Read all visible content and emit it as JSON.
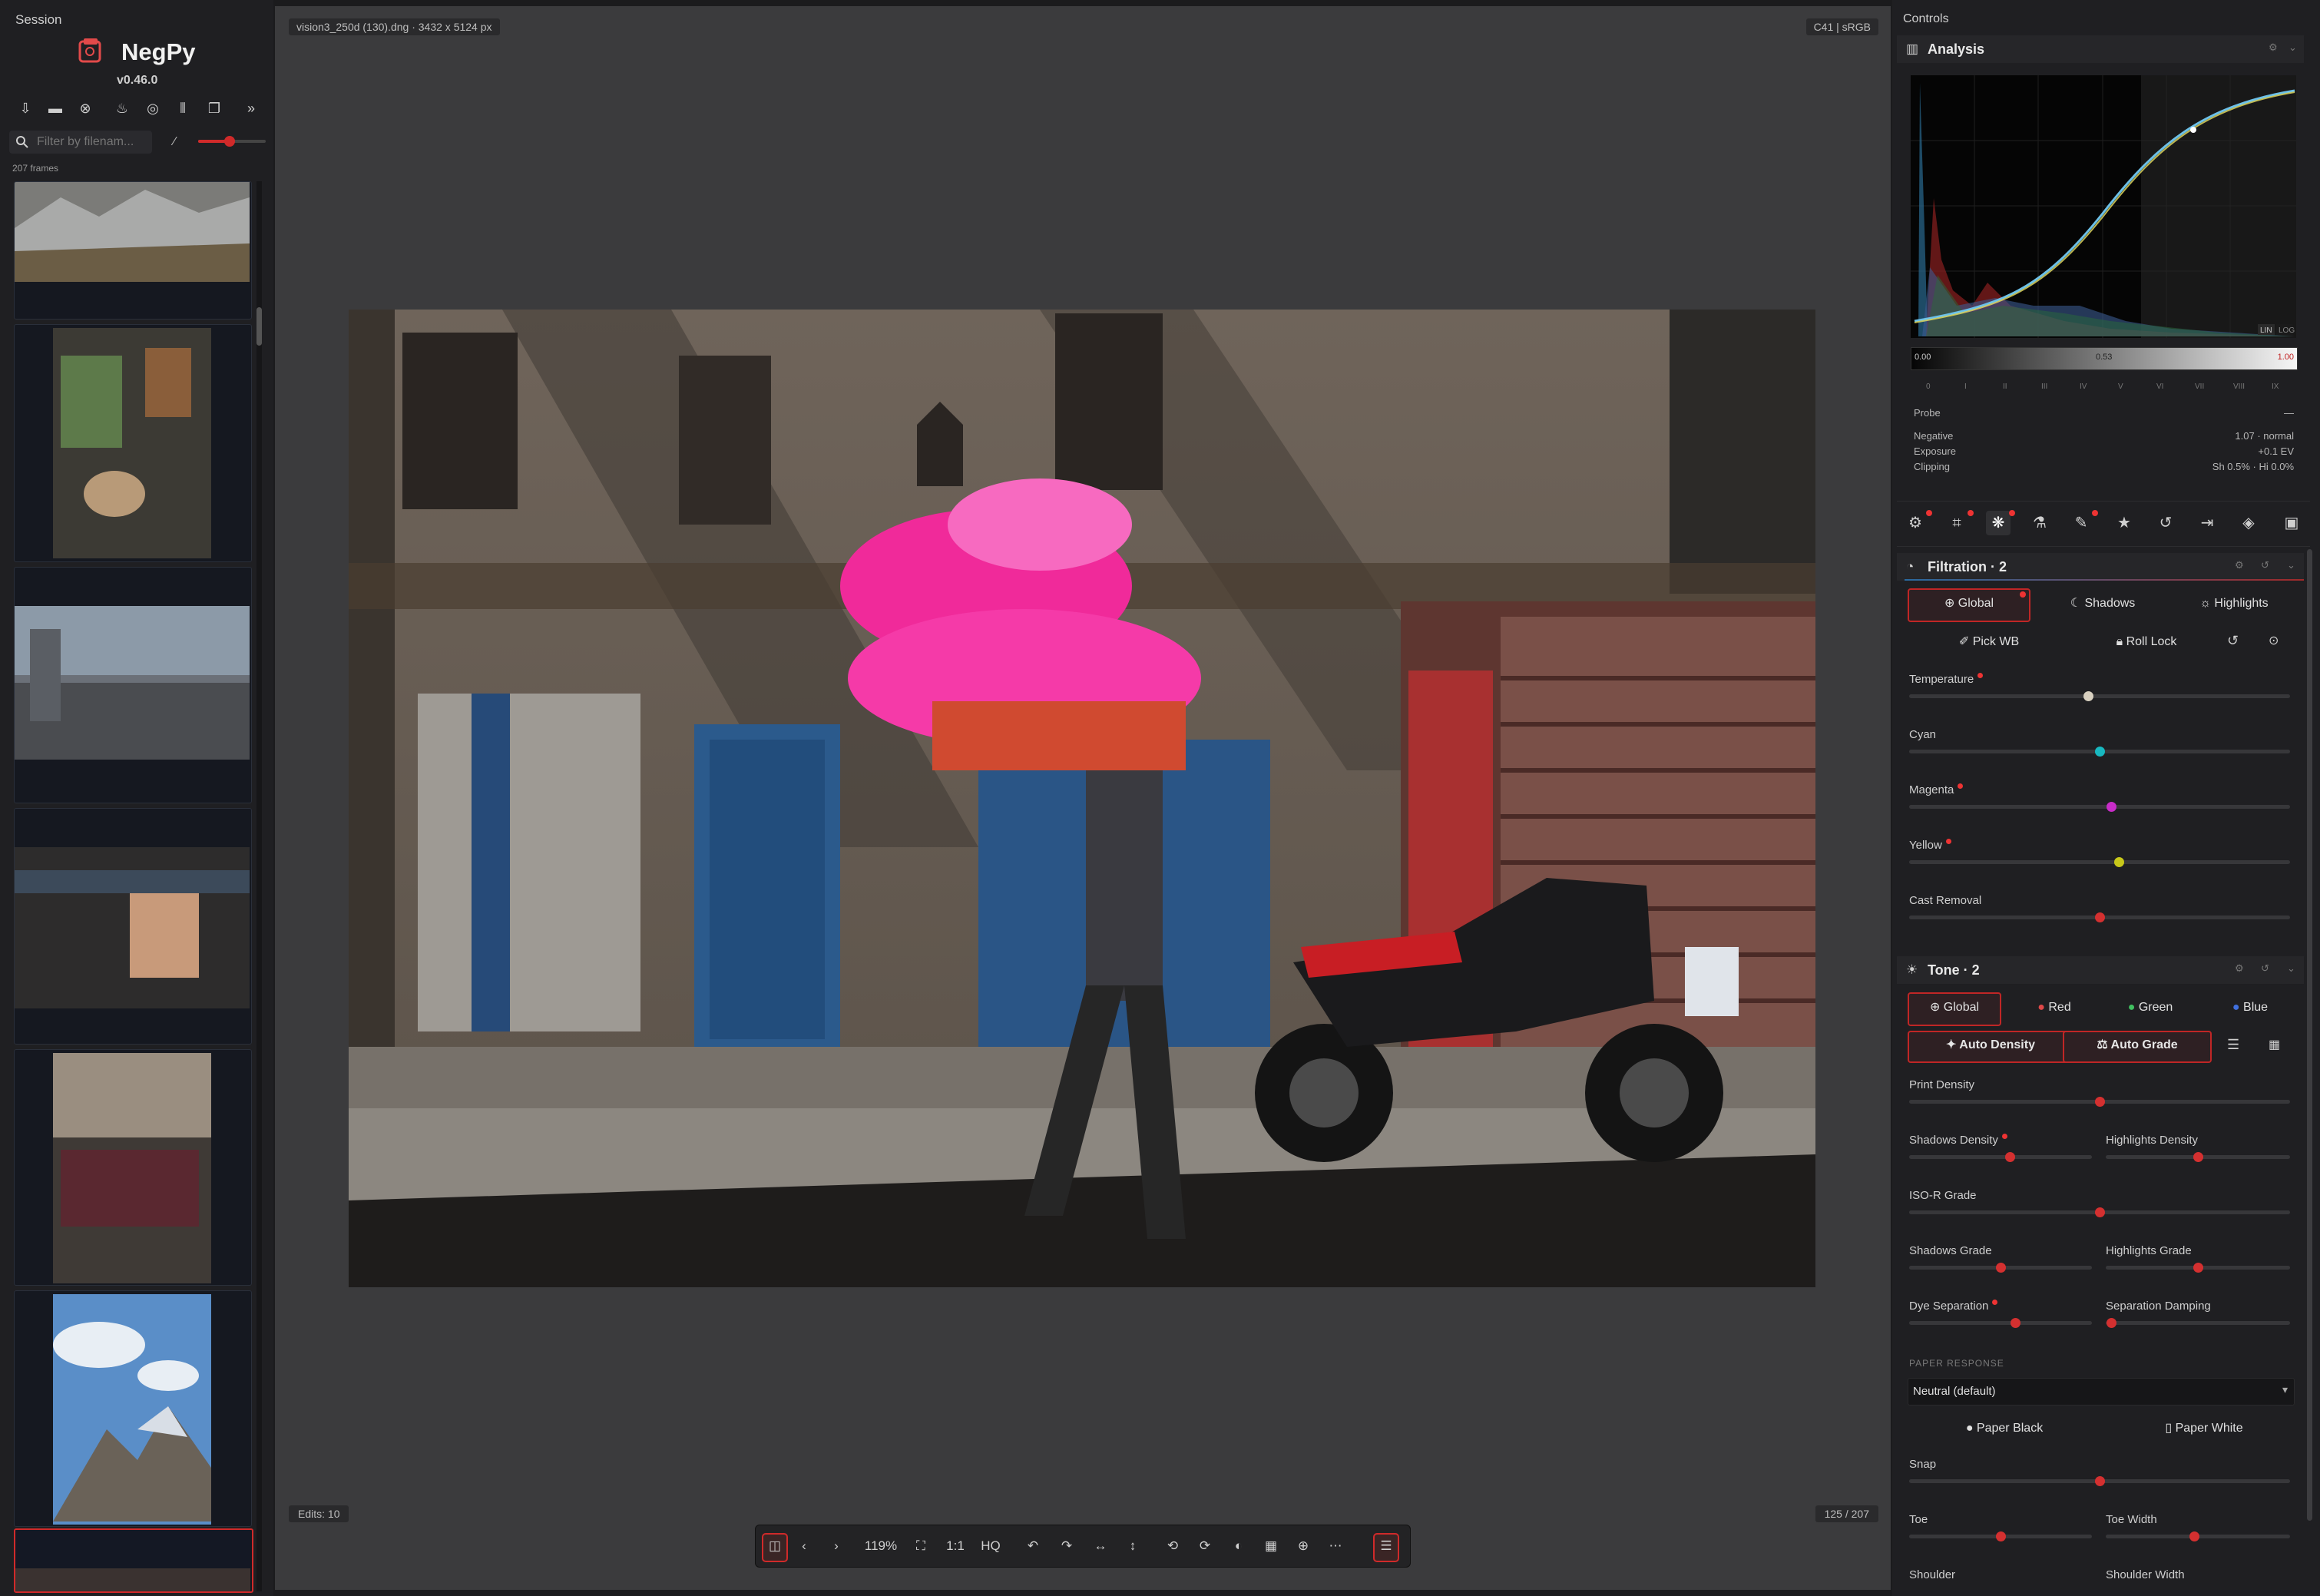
{
  "left_panel": {
    "title": "Session",
    "app_name": "NegPy",
    "version": "v0.46.0",
    "toolbar_icons": [
      "import-file-icon",
      "open-folder-icon",
      "close-icon",
      "flame-icon",
      "target-icon",
      "columns-icon",
      "copy-icon",
      "expand-icon"
    ],
    "filter_placeholder": "Filter by filenam...",
    "frames_count": "207 frames"
  },
  "viewer": {
    "file_info": "vision3_250d (130).dng · 3432 x 5124 px",
    "color_info": "C41 | sRGB",
    "edits": "Edits: 10",
    "counter": "125 / 207",
    "toolbar": {
      "zoom": "119%",
      "one_to_one": "1:1",
      "hq": "HQ"
    }
  },
  "controls": {
    "title": "Controls",
    "analysis": {
      "title": "Analysis",
      "lin_label": "LIN",
      "log_label": "LOG",
      "gradient_left": "0.00",
      "gradient_mid": "0.53",
      "gradient_right": "1.00",
      "zones": [
        "0",
        "I",
        "II",
        "III",
        "IV",
        "V",
        "VI",
        "VII",
        "VIII",
        "IX"
      ],
      "probe_label": "Probe",
      "probe_dash": "—",
      "negative_label": "Negative",
      "negative_value": "1.07 · normal",
      "exposure_label": "Exposure",
      "exposure_value": "+0.1 EV",
      "clipping_label": "Clipping",
      "clipping_value": "Sh 0.5% · Hi 0.0%"
    },
    "filtration": {
      "title": "Filtration · 2",
      "tabs": [
        "Global",
        "Shadows",
        "Highlights"
      ],
      "pick_wb": "Pick WB",
      "roll_lock": "Roll Lock",
      "sliders": [
        {
          "label": "Temperature",
          "value": 0.47,
          "color": "#d8d0c0",
          "modified": true
        },
        {
          "label": "Cyan",
          "value": 0.5,
          "color": "#18b8c0",
          "modified": false
        },
        {
          "label": "Magenta",
          "value": 0.53,
          "color": "#c82cc8",
          "modified": true
        },
        {
          "label": "Yellow",
          "value": 0.55,
          "color": "#c8c81a",
          "modified": true
        },
        {
          "label": "Cast Removal",
          "value": 0.5,
          "color": "#d43030",
          "modified": false
        }
      ]
    },
    "tone": {
      "title": "Tone · 2",
      "tabs": [
        "Global",
        "Red",
        "Green",
        "Blue"
      ],
      "auto_density": "Auto Density",
      "auto_grade": "Auto Grade",
      "print_density": {
        "label": "Print Density",
        "value": 0.5
      },
      "shadows_density": {
        "label": "Shadows Density",
        "value": 0.55
      },
      "highlights_density": {
        "label": "Highlights Density",
        "value": 0.5
      },
      "iso_r_grade": {
        "label": "ISO-R Grade",
        "value": 0.5
      },
      "shadows_grade": {
        "label": "Shadows Grade",
        "value": 0.5
      },
      "highlights_grade": {
        "label": "Highlights Grade",
        "value": 0.5
      },
      "dye_separation": {
        "label": "Dye Separation",
        "value": 0.58
      },
      "separation_damping": {
        "label": "Separation Damping",
        "value": 0.03
      },
      "paper_response_heading": "PAPER RESPONSE",
      "paper_response_value": "Neutral (default)",
      "paper_black": "Paper Black",
      "paper_white": "Paper White",
      "snap": {
        "label": "Snap",
        "value": 0.5
      },
      "toe": {
        "label": "Toe",
        "value": 0.5
      },
      "toe_width": {
        "label": "Toe Width",
        "value": 0.48
      },
      "shoulder": {
        "label": "Shoulder"
      },
      "shoulder_width": {
        "label": "Shoulder Width"
      }
    }
  }
}
